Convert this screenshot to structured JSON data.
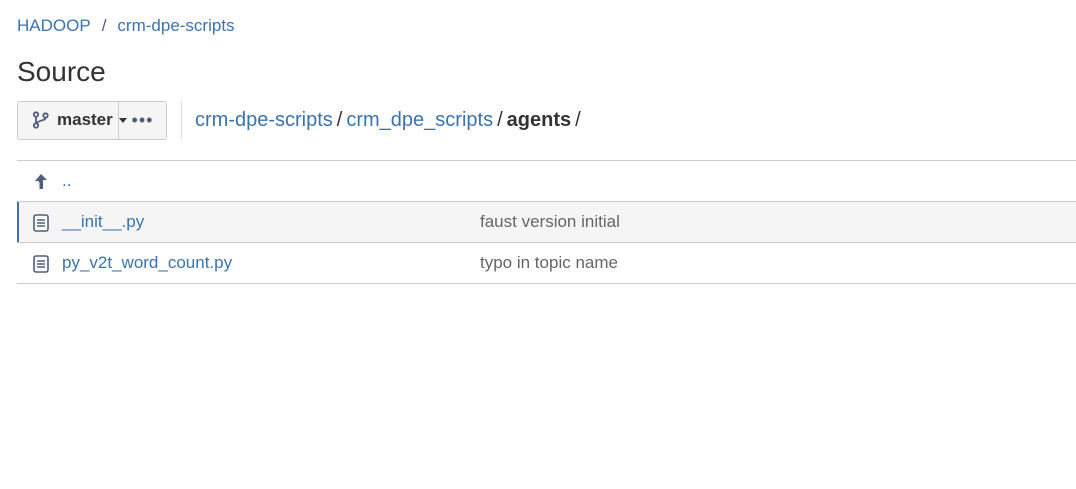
{
  "breadcrumb": {
    "project": "HADOOP",
    "separator": "/",
    "repo": "crm-dpe-scripts"
  },
  "page_title": "Source",
  "toolbar": {
    "branch_label": "master",
    "more_label": "•••"
  },
  "path": {
    "segments": [
      "crm-dpe-scripts",
      "crm_dpe_scripts"
    ],
    "current": "agents",
    "separator": "/"
  },
  "files": {
    "parent_label": "..",
    "rows": [
      {
        "name": "__init__.py",
        "message": "faust version initial"
      },
      {
        "name": "py_v2t_word_count.py",
        "message": "typo in topic name"
      }
    ]
  },
  "colors": {
    "link": "#3b73af",
    "selected_row_bg": "#f5f5f5",
    "selected_row_accent": "#3b73af"
  },
  "icons": {
    "branch": "git-branch-icon",
    "caret": "caret-down-icon",
    "up": "arrow-up-parent-icon",
    "file": "file-icon"
  }
}
